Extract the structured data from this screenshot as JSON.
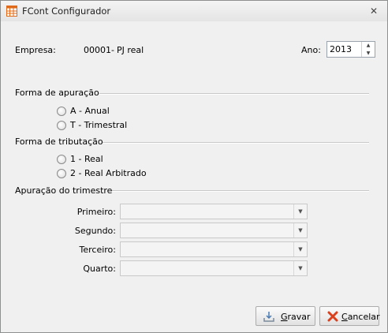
{
  "window": {
    "title": "FCont Configurador"
  },
  "empresa": {
    "label": "Empresa:",
    "code": "00001-",
    "name": "PJ real"
  },
  "ano": {
    "label": "Ano:",
    "value": "2013"
  },
  "apuracao": {
    "title": "Forma de apuração",
    "options": [
      "A - Anual",
      "T - Trimestral"
    ]
  },
  "tributacao": {
    "title": "Forma de tributação",
    "options": [
      "1 - Real",
      "2 - Real Arbitrado"
    ]
  },
  "trimestre": {
    "title": "Apuração do trimestre",
    "fields": [
      "Primeiro:",
      "Segundo:",
      "Terceiro:",
      "Quarto:"
    ]
  },
  "buttons": {
    "save": {
      "prefix": "G",
      "rest": "ravar"
    },
    "cancel": {
      "prefix": "C",
      "rest": "ancelar"
    }
  },
  "icons": {
    "app": "spreadsheet-icon",
    "close": "close-icon",
    "save": "save-icon",
    "cancel": "cancel-icon"
  },
  "colors": {
    "cancel_icon": "#d9411e",
    "app_icon": "#e06a1b"
  }
}
